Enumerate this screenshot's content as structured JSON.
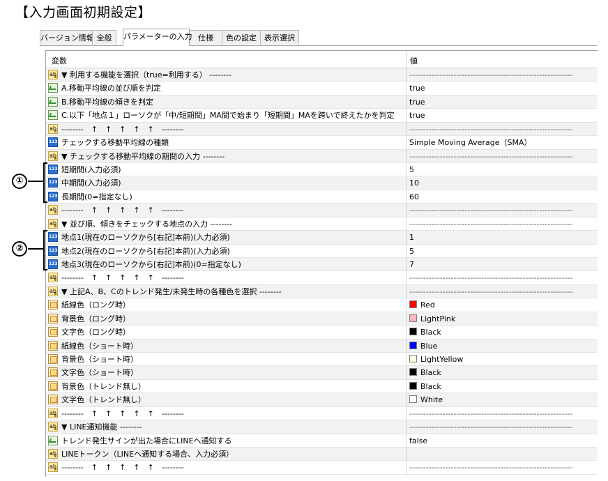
{
  "page_title": "【入力画面初期設定】",
  "tabs": [
    {
      "label": "バージョン情報",
      "active": false
    },
    {
      "label": "全般",
      "active": false
    },
    {
      "label": "パラメーターの入力",
      "active": true
    },
    {
      "label": "仕様",
      "active": false
    },
    {
      "label": "色の設定",
      "active": false
    },
    {
      "label": "表示選択",
      "active": false
    }
  ],
  "table": {
    "header_variable": "変数",
    "header_value": "値",
    "rows": [
      {
        "icon": "ab",
        "name": "▼ 利用する機能を選択（true=利用する） --------",
        "value": "-----------------------------------------------------------"
      },
      {
        "icon": "bool",
        "name": "A.移動平均線の並び順を判定",
        "value": "true"
      },
      {
        "icon": "bool",
        "name": "B.移動平均線の傾きを判定",
        "value": "true"
      },
      {
        "icon": "bool",
        "name": "C.以下「地点１」ローソクが「中/短期間」MA間で始まり「短期間」MAを跨いで終えたかを判定",
        "value": "true"
      },
      {
        "icon": "ab",
        "name": "--------　↑　↑　↑　↑　↑　--------",
        "value": "-----------------------------------------------------------"
      },
      {
        "icon": "int",
        "name": "チェックする移動平均線の種類",
        "value": "Simple Moving Average（SMA）"
      },
      {
        "icon": "ab",
        "name": "▼ チェックする移動平均線の期間の入力 --------",
        "value": "-----------------------------------------------------------"
      },
      {
        "icon": "int",
        "name": "短期間(入力必須)",
        "value": "5"
      },
      {
        "icon": "int",
        "name": "中期間(入力必須)",
        "value": "10"
      },
      {
        "icon": "int",
        "name": "長期間(0=指定なし)",
        "value": "60"
      },
      {
        "icon": "ab",
        "name": "--------　↑　↑　↑　↑　↑　--------",
        "value": "-----------------------------------------------------------"
      },
      {
        "icon": "ab",
        "name": "▼ 並び順、傾きをチェックする地点の入力 --------",
        "value": "-----------------------------------------------------------"
      },
      {
        "icon": "int",
        "name": "地点1(現在のローソクから[右記]本前)(入力必須)",
        "value": "1"
      },
      {
        "icon": "int",
        "name": "地点2(現在のローソクから[右記]本前)(入力必須)",
        "value": "5"
      },
      {
        "icon": "int",
        "name": "地点3(現在のローソクから[右記]本前)(0=指定なし)",
        "value": "7"
      },
      {
        "icon": "ab",
        "name": "--------　↑　↑　↑　↑　↑　--------",
        "value": "-----------------------------------------------------------"
      },
      {
        "icon": "ab",
        "name": "▼ 上記A、B、Cのトレンド発生/未発生時の各種色を選択 --------",
        "value": "-----------------------------------------------------------"
      },
      {
        "icon": "color",
        "name": "紙線色（ロング時）",
        "value": "Red",
        "swatch": "#ff0000"
      },
      {
        "icon": "color",
        "name": "背景色（ロング時）",
        "value": "LightPink",
        "swatch": "#ffb6c1"
      },
      {
        "icon": "color",
        "name": "文字色（ロング時）",
        "value": "Black",
        "swatch": "#000000"
      },
      {
        "icon": "color",
        "name": "紙線色（ショート時）",
        "value": "Blue",
        "swatch": "#0000ff"
      },
      {
        "icon": "color",
        "name": "背景色（ショート時）",
        "value": "LightYellow",
        "swatch": "#ffffe0"
      },
      {
        "icon": "color",
        "name": "文字色（ショート時）",
        "value": "Black",
        "swatch": "#000000"
      },
      {
        "icon": "color",
        "name": "背景色（トレンド無し）",
        "value": "Black",
        "swatch": "#000000"
      },
      {
        "icon": "color",
        "name": "文字色（トレンド無し）",
        "value": "White",
        "swatch": "#ffffff"
      },
      {
        "icon": "ab",
        "name": "--------　↑　↑　↑　↑　↑　--------",
        "value": "-----------------------------------------------------------"
      },
      {
        "icon": "ab",
        "name": "▼ LINE通知機能 --------",
        "value": "-----------------------------------------------------------"
      },
      {
        "icon": "bool",
        "name": "トレンド発生サインが出た場合にLINEへ通知する",
        "value": "false"
      },
      {
        "icon": "ab",
        "name": "LINEトークン（LINEへ通知する場合、入力必須）",
        "value": ""
      },
      {
        "icon": "ab",
        "name": "--------　↑　↑　↑　↑　↑　--------",
        "value": "-----------------------------------------------------------"
      }
    ]
  },
  "annotations": [
    "①",
    "②"
  ]
}
